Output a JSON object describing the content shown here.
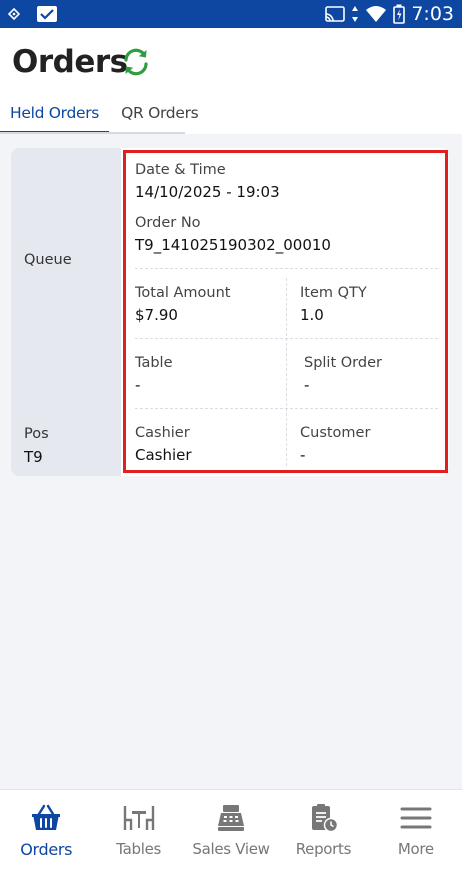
{
  "status_bar": {
    "time": "7:03"
  },
  "header": {
    "title": "Orders"
  },
  "tabs": [
    {
      "label": "Held Orders",
      "active": true
    },
    {
      "label": "QR Orders",
      "active": false
    }
  ],
  "order_card": {
    "queue_label": "Queue",
    "pos_label": "Pos",
    "pos_value": "T9",
    "date_time_label": "Date & Time",
    "date_time_value": "14/10/2025 - 19:03",
    "order_no_label": "Order No",
    "order_no_value": "T9_141025190302_00010",
    "total_amount_label": "Total Amount",
    "total_amount_value": "$7.90",
    "item_qty_label": "Item QTY",
    "item_qty_value": "1.0",
    "table_label": "Table",
    "table_value": "-",
    "split_order_label": "Split Order",
    "split_order_value": "-",
    "cashier_label": "Cashier",
    "cashier_value": "Cashier",
    "customer_label": "Customer",
    "customer_value": "-"
  },
  "bottom_nav": [
    {
      "label": "Orders",
      "icon": "basket-icon",
      "active": true
    },
    {
      "label": "Tables",
      "icon": "table-chairs-icon",
      "active": false
    },
    {
      "label": "Sales View",
      "icon": "cash-register-icon",
      "active": false
    },
    {
      "label": "Reports",
      "icon": "clipboard-clock-icon",
      "active": false
    },
    {
      "label": "More",
      "icon": "hamburger-menu-icon",
      "active": false
    }
  ],
  "colors": {
    "primary": "#0d47a1",
    "highlight_border": "#e0201f",
    "refresh_green": "#2e9e3e"
  }
}
